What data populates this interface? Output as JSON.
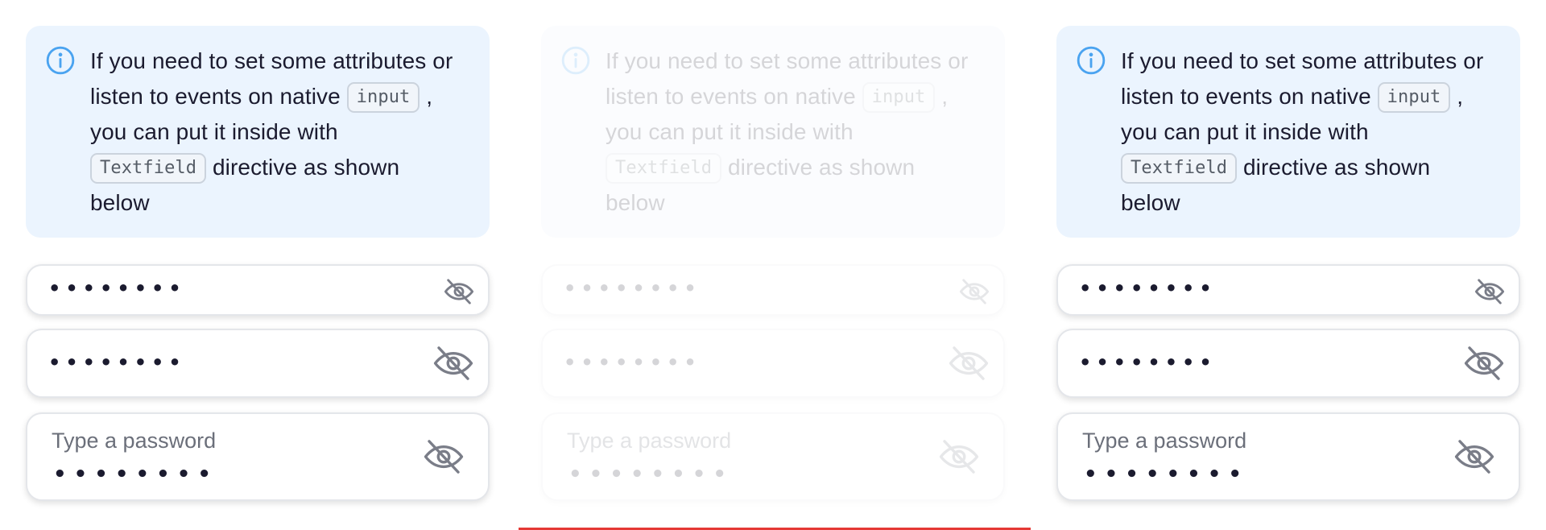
{
  "colors": {
    "info_bg": "#ebf4fe",
    "info_icon": "#4aa3f0",
    "text": "#1b1b2f",
    "label": "#6b6f7a",
    "eye_icon": "#7a7d88",
    "accent_line": "#e53935"
  },
  "panels": [
    {
      "state": "enabled",
      "info": {
        "icon": "info-circle-icon",
        "text_1": "If you need to set some attributes or listen to events on native ",
        "code_1": "input",
        "text_2": " , you can put it inside with ",
        "code_2": "Textfield",
        "text_3": " directive as shown below"
      },
      "field_1": {
        "value": "••••••••",
        "icon": "eye-off-icon"
      },
      "field_2": {
        "value": "••••••••",
        "icon": "eye-off-icon"
      },
      "field_3": {
        "label": "Type a password",
        "value": "••••••••",
        "icon": "eye-off-icon"
      }
    },
    {
      "state": "disabled",
      "info": {
        "icon": "info-circle-icon",
        "text_1": "If you need to set some attributes or listen to events on native ",
        "code_1": "input",
        "text_2": " , you can put it inside with ",
        "code_2": "Textfield",
        "text_3": " directive as shown below"
      },
      "field_1": {
        "value": "••••••••",
        "icon": "eye-off-icon"
      },
      "field_2": {
        "value": "••••••••",
        "icon": "eye-off-icon"
      },
      "field_3": {
        "label": "Type a password",
        "value": "••••••••",
        "icon": "eye-off-icon"
      }
    },
    {
      "state": "enabled",
      "info": {
        "icon": "info-circle-icon",
        "text_1": "If you need to set some attributes or listen to events on native ",
        "code_1": "input",
        "text_2": " , you can put it inside with ",
        "code_2": "Textfield",
        "text_3": " directive as shown below"
      },
      "field_1": {
        "value": "••••••••",
        "icon": "eye-off-icon"
      },
      "field_2": {
        "value": "••••••••",
        "icon": "eye-off-icon"
      },
      "field_3": {
        "label": "Type a password",
        "value": "••••••••",
        "icon": "eye-off-icon"
      }
    }
  ]
}
